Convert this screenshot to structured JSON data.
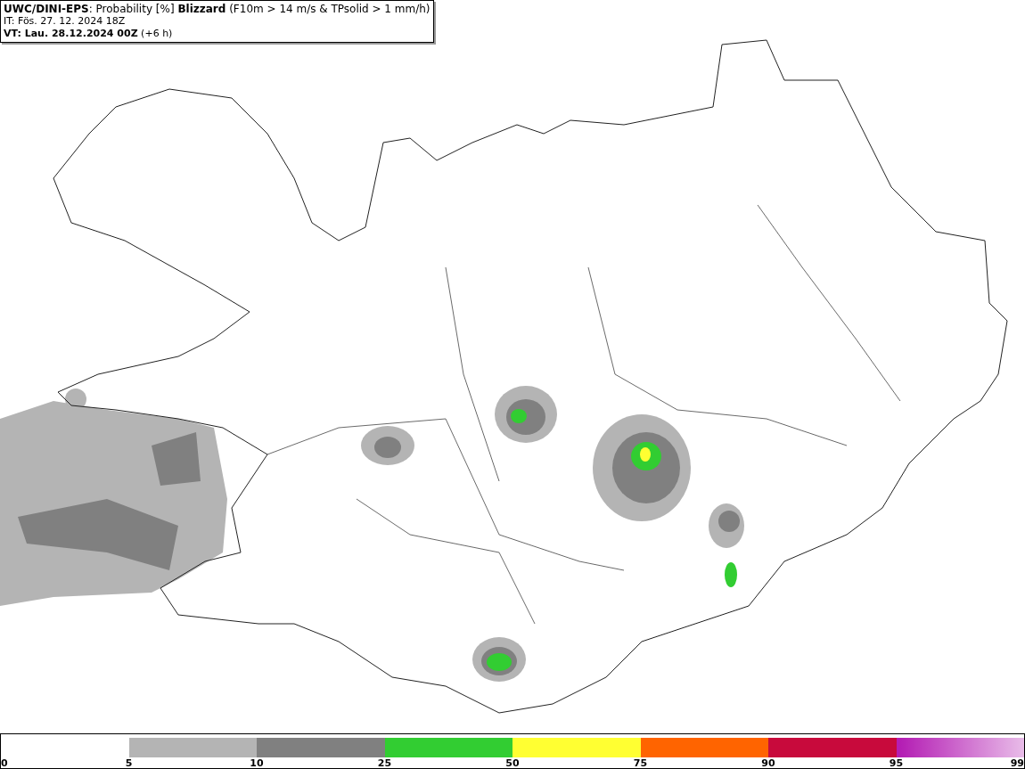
{
  "header": {
    "lines": [
      "**UWC/DINI-EPS**: Probability [%] **Blizzard** (F10m > 14 m/s & TPsolid > 1 mm/h)",
      "IT: Fös. 27. 12. 2024 18Z",
      "**VT: Lau. 28.12.2024 00Z** (+6 h)"
    ]
  },
  "legend": {
    "segments": [
      {
        "kind": "solid",
        "color": "#b4b4b4"
      },
      {
        "kind": "solid",
        "color": "#808080"
      },
      {
        "kind": "solid",
        "color": "#32cd32"
      },
      {
        "kind": "solid",
        "color": "#ffff32"
      },
      {
        "kind": "solid",
        "color": "#ff6400"
      },
      {
        "kind": "solid",
        "color": "#c80a3c"
      },
      {
        "kind": "gradient",
        "color": "#b41eb4"
      }
    ],
    "ticks": [
      "0",
      "5",
      "10",
      "25",
      "50",
      "75",
      "90",
      "95",
      "99"
    ]
  }
}
